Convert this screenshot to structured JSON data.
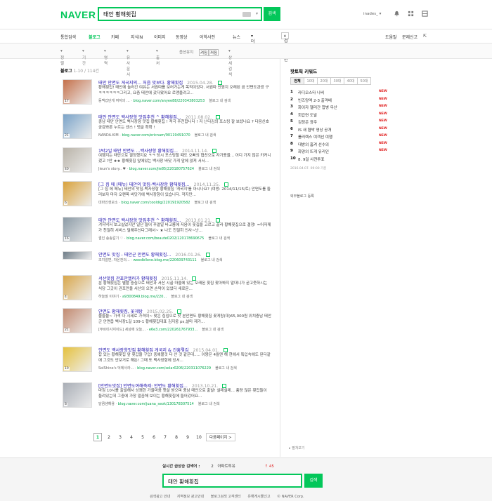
{
  "header": {
    "logo": "NAVER",
    "query": "태안 황해횟집",
    "search_label": "검색",
    "user": "inades_"
  },
  "nav": {
    "tabs": [
      {
        "label": "통합검색",
        "active": false
      },
      {
        "label": "블로그",
        "active": true
      },
      {
        "label": "카페",
        "active": false
      },
      {
        "label": "지식iN",
        "active": false
      },
      {
        "label": "이미지",
        "active": false
      },
      {
        "label": "동영상",
        "active": false
      },
      {
        "label": "어학사전",
        "active": false
      },
      {
        "label": "뉴스",
        "active": false
      },
      {
        "label": "더보기",
        "active": false
      }
    ],
    "options_label": "검색옵션",
    "help": "도움말",
    "feedback": "문제신고"
  },
  "subnav": {
    "items": [
      "정렬",
      "기간",
      "영역",
      "유사문서",
      "출처"
    ],
    "exclude_label": "옵션유지",
    "chip_on": "켜짐",
    "chip_off": "꺼짐",
    "detail": "상세검색"
  },
  "results_header": {
    "label": "블로그",
    "count": "1-10 / 114건"
  },
  "results": [
    {
      "title": "태안 안면도 게국지의... 처음 맛보다. 황해횟집",
      "date": "2015.04.28.",
      "desc": "황해횟집! 태안에 놀러간 여유는 서권따를 보러가는게 목적이었다. 서권따 안원지 오래된 곰 안면도관광 구 ㅋㅋㅋㅋㅋㅋ그리고, 요즘 태안에 갔다왔어요 로맹을려고...",
      "source": "동맥갔던게 여자의 ... ",
      "url": "blog.naver.com/anyee88/220343803253",
      "extra": "블로그 내 검색",
      "count": "17",
      "thumb_color": "#c4704a"
    },
    {
      "title": "태안 안면도 백사장항 맛집추천 ^ 황해횟집...",
      "date": "2011.08.02.",
      "desc": "충남 태안 안면도 백사장항 맛집 황해횟집 ! 적극 추천합니다 ! 저 난다김의 포스팅 잘 보셨나요 ? 다음신호 궁감봐른 누르는 센스 ! 댓글 확확 !",
      "source": "NANDA.KIM",
      "url": "blog.naver.com/ericnam/90119491070",
      "extra": "블로그 내 검색",
      "count": "21",
      "thumb_color": "#7aa3c8"
    },
    {
      "title": "1박2일 태안 안면도 ...백사장항 황해횟집...",
      "date": "2014.11.14.",
      "desc": "여행지는 태안으로 결정했지요 ㅋㅋ 당시 포스팅할 때도 오빠의 협찬으로 자가용을... 어디 가지 않은 카커니겠고 ?안 ★★ 황해횟집 앞에있는 백사장 바닷 가게 앞에 앉져 서서...",
      "source": "Jieun's story.. ♥",
      "url": "blog.naver.com/jie85/220180757624",
      "extra": "블로그 내 검색",
      "count": "40",
      "thumb_color": "#b9b3a8"
    },
    {
      "title": "[그 집 에 (메뉴) 태안의 맛집-백사장항 황해횟집...",
      "date": "2014.11.25.",
      "desc": "[그 집 에 메뉴] 태안의 맛집-백사장항 황해횟집 '게국지'를 아시나요? (여방: 2014/11/15/토) 안면도를 둘러보자 마자 오랜목 바닷가에 백사장항이 있습니다. 작지만...",
      "source": "대마인생모소",
      "url": "blog.naver.com/cooldig/220191920582",
      "extra": "블로그 내 검색",
      "count": "6",
      "thumb_color": "#d9a23b"
    },
    {
      "title": "태안 안면도 백사장항 맛집추천 ^ 황해횟집...",
      "date": "2013.01.21.",
      "desc": "겨저녁서 보고실었지만 일단 들어 푸얼일 바고름에 저음이 횟집을 고르고 골라 황해횟집으로 결정! =어저께가 친절히 서비스 덜해주신다그래서~ ★ 나도 친절히 인사~난...",
      "source": "결인 송송갈기 ♡",
      "url": "blog.naver.com/beaute0202/120178690675",
      "extra": "블로그 내 검색",
      "count": "16",
      "thumb_color": "#8b9aa5"
    },
    {
      "title": "안면도 맛집 - 태안군 안면도 황해횟집...",
      "date": "2016.01.26.",
      "desc": "",
      "source": "조지알면, 자온전의...",
      "url": "woodbllove.blog.me/220609743111",
      "extra": "블로그 내 검색",
      "count": "",
      "thumb_color": "#6f7d88"
    },
    {
      "title": "서산맛집 관포만엘러가 황해횟집",
      "date": "2015.11.14.",
      "desc": "분 황해횟집은 별플 중심으로 태안과 서산 시골 마을에 있는 오래된 횟집 찾아봐지 말대니가 굳고줏하시는 식당 그곳이 관포만을 서산의 오면 손막이 있었다 새로운...",
      "source": "하늘말 이야기",
      "url": "a9300849.blog.me/220...",
      "extra": "블로그 내 검색",
      "count": "4",
      "thumb_color": "#d8a64a"
    },
    {
      "title": "안면도 황해횟집, 꽃게탕",
      "date": "2015.02.25.",
      "desc": "물들물~ 가격 다 시세로 가격이~ 맞은 집입으로 맛 본안면도 황해횟집 꽃게탕(대)65,000원 위치충남 태안군 안면읍 백사장1길 109-1 황해횟집대표 김지웅 ps,설마 제가...",
      "source": "[푸르미사지이드] 세상에 오늘...",
      "url": "e6e3.com/220261767933...",
      "extra": "블로그 내 검색",
      "count": "21",
      "thumb_color": "#c28a70"
    },
    {
      "title": "안면도 백사장항맛집 황해횟집 게국지 & 간흥뤄김",
      "date": "2015.04.01.",
      "desc": "잡 있는 황해횟집 앞 횟갑을 구입! 중헤볼것 다 산 것 같은데..... 이왕은 4월엔 해 현에서 특입속에도 된다같애 그것도 안보거로 해든! 그때 또 백사장항에 있서...",
      "source": "SolShine's 덕에사라...",
      "url": "blog.naver.com/solar0206/220311076229",
      "extra": "블로그 내 검색",
      "count": "19",
      "thumb_color": "#e5c13d"
    },
    {
      "title": "[안면도맛집] 안면도여해축제: 안면도 황해횟집...",
      "date": "2013.10.21.",
      "desc": "마침 10시를 출발해서 상쾌한 가을마음 햇살 받으며 충남 태안으로 출발! 설레설레... 총량 많은 횟집들이 들려있는데 그중에 가장 말끔해 보이는 황해횟집에 들어갔어요...",
      "source": "달콤샘해용",
      "url": "blog.naver.com/juana_seok/130178307514",
      "extra": "블로그 내 검색",
      "count": "8",
      "thumb_color": "#a9aeb6"
    }
  ],
  "pager": {
    "pages": [
      "1",
      "2",
      "3",
      "4",
      "5",
      "6",
      "7",
      "8",
      "9",
      "10"
    ],
    "next": "다음페이지 >"
  },
  "side": {
    "title": "핫토픽 키워드",
    "tabs": [
      "전체",
      "10대",
      "20대",
      "30대",
      "40대",
      "50대"
    ],
    "keywords": [
      {
        "rank": "1",
        "text": "라디오스타 나비",
        "new": "NEW"
      },
      {
        "rank": "2",
        "text": "빈즈양액 2-3 출격배",
        "new": "NEW"
      },
      {
        "rank": "3",
        "text": "화이자 헬러간 합병 무산",
        "new": "NEW"
      },
      {
        "rank": "4",
        "text": "회갑연 도발",
        "new": "NEW"
      },
      {
        "rank": "5",
        "text": "김정은 광주",
        "new": "NEW"
      },
      {
        "rank": "6",
        "text": "IS 새 협박 영상 공개",
        "new": "NEW"
      },
      {
        "rank": "7",
        "text": "롤러렉스 여객선 여행",
        "new": "NEW"
      },
      {
        "rank": "8",
        "text": "대방의 홈켜 선수의",
        "new": "NEW"
      },
      {
        "rank": "9",
        "text": "화양의 뜨게 유리인",
        "new": "NEW"
      },
      {
        "rank": "10",
        "text": "8. 9일 사전투표",
        "new": ""
      }
    ],
    "timestamp": "2016.04.07. 09:00 기준",
    "more": "외부블로그 등록",
    "close": "▸ 펼쳐보기"
  },
  "bottom": {
    "realtime_label": "실시간 급상승 검색어 :",
    "realtime_rank": "2",
    "realtime_term": "아파트투유",
    "realtime_change": "↑ 45",
    "query": "태안 황해횟집",
    "search_label": "검색",
    "footer_links": [
      "검색광고 안내",
      "지역정보 광고안내",
      "블로그검색 고객센터",
      "유해게시물신고",
      "© NAVER Corp."
    ]
  },
  "colors": {
    "brand": "#03c75a",
    "link": "#1a0dab",
    "url": "#03a94f",
    "new": "#e02020"
  }
}
